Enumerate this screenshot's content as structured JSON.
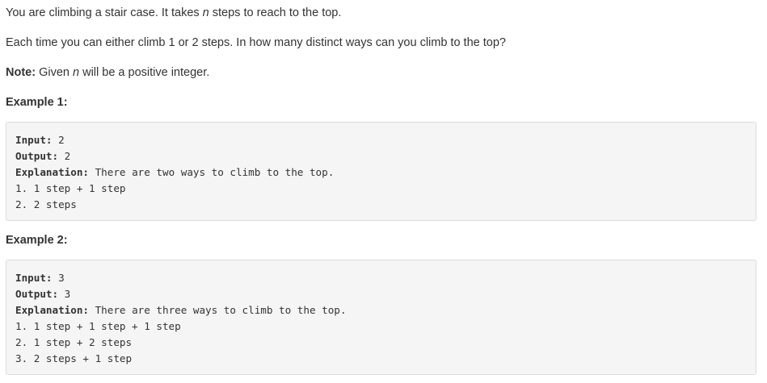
{
  "description": {
    "p1_before": "You are climbing a stair case. It takes ",
    "p1_var": "n",
    "p1_after": " steps to reach to the top.",
    "p2": "Each time you can either climb 1 or 2 steps. In how many distinct ways can you climb to the top?",
    "note_label": "Note:",
    "note_before": " Given ",
    "note_var": "n",
    "note_after": " will be a positive integer."
  },
  "examples": [
    {
      "heading": "Example 1:",
      "input_label": "Input:",
      "input_value": " 2",
      "output_label": "Output:",
      "output_value": " 2",
      "explanation_label": "Explanation:",
      "explanation_value": " There are two ways to climb to the top.",
      "lines": [
        "1. 1 step + 1 step",
        "2. 2 steps"
      ]
    },
    {
      "heading": "Example 2:",
      "input_label": "Input:",
      "input_value": " 3",
      "output_label": "Output:",
      "output_value": " 3",
      "explanation_label": "Explanation:",
      "explanation_value": " There are three ways to climb to the top.",
      "lines": [
        "1. 1 step + 1 step + 1 step",
        "2. 1 step + 2 steps",
        "3. 2 steps + 1 step"
      ]
    }
  ]
}
